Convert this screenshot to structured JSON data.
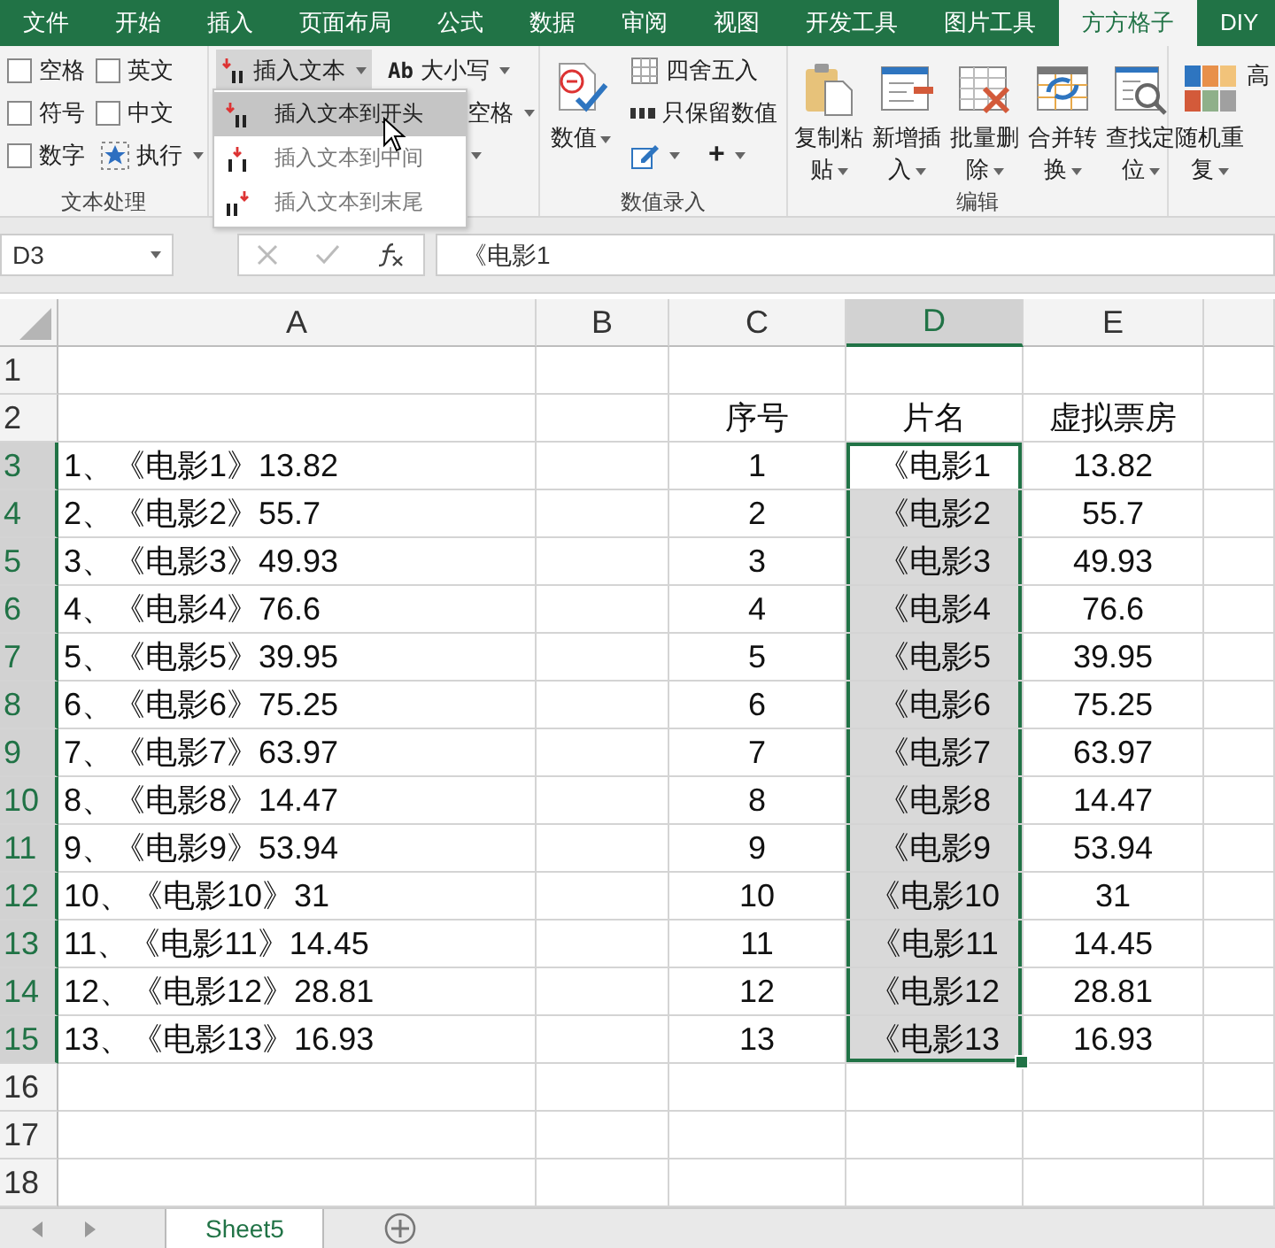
{
  "menu_tabs": [
    {
      "label": "文件",
      "selected": false
    },
    {
      "label": "开始",
      "selected": false
    },
    {
      "label": "插入",
      "selected": false
    },
    {
      "label": "页面布局",
      "selected": false
    },
    {
      "label": "公式",
      "selected": false
    },
    {
      "label": "数据",
      "selected": false
    },
    {
      "label": "审阅",
      "selected": false
    },
    {
      "label": "视图",
      "selected": false
    },
    {
      "label": "开发工具",
      "selected": false
    },
    {
      "label": "图片工具",
      "selected": false
    },
    {
      "label": "方方格子",
      "selected": true
    },
    {
      "label": "DIY",
      "selected": false
    }
  ],
  "ribbon": {
    "groups": [
      {
        "label": "文本处理",
        "columns": [
          [
            {
              "kind": "check",
              "label": "空格",
              "checked": false
            },
            {
              "kind": "check",
              "label": "符号",
              "checked": false
            },
            {
              "kind": "check",
              "label": "数字",
              "checked": false
            }
          ],
          [
            {
              "kind": "check",
              "label": "英文",
              "checked": false
            },
            {
              "kind": "check",
              "label": "中文",
              "checked": false
            },
            {
              "kind": "button",
              "label": "执行",
              "dropdown": true
            }
          ]
        ]
      },
      {
        "columns": [
          [
            {
              "kind": "button",
              "label": "插入文本",
              "dropdown": true,
              "expanded": true
            }
          ],
          [
            {
              "kind": "button",
              "badge": "Ab",
              "label": "大小写",
              "dropdown": true
            },
            {
              "kind": "button",
              "label": "空格",
              "dropdown": true
            },
            {
              "kind": "button",
              "dropdown": true
            }
          ]
        ]
      },
      {
        "label": "数值录入",
        "columns": [
          [
            {
              "kind": "large",
              "label": "数值",
              "dropdown": true
            }
          ],
          [
            {
              "kind": "button",
              "label": "四舍五入"
            },
            {
              "kind": "button",
              "label": "只保留数值"
            },
            {
              "kind": "tools",
              "items": [
                {
                  "dropdown": true
                },
                {
                  "label": "+",
                  "dropdown": true
                }
              ]
            }
          ]
        ]
      },
      {
        "label": "编辑",
        "columns": [
          [
            {
              "kind": "large",
              "label": "复制粘贴",
              "dropdown": true
            }
          ],
          [
            {
              "kind": "large",
              "label": "新增插入",
              "dropdown": true
            }
          ],
          [
            {
              "kind": "large",
              "label": "批量删除",
              "dropdown": true
            }
          ],
          [
            {
              "kind": "large",
              "label": "合并转换",
              "dropdown": true
            }
          ],
          [
            {
              "kind": "large",
              "label": "查找定位",
              "dropdown": true
            }
          ]
        ]
      },
      {
        "columns": [
          [
            {
              "kind": "large",
              "label": "随机重复",
              "dropdown": true
            }
          ],
          [
            {
              "kind": "large",
              "label": "高"
            }
          ]
        ]
      }
    ]
  },
  "dropdown_menu": {
    "items": [
      {
        "label": "插入文本到开头",
        "selected": true
      },
      {
        "label": "插入文本到中间",
        "selected": false
      },
      {
        "label": "插入文本到末尾",
        "selected": false
      }
    ]
  },
  "name_box": "D3",
  "formula": "《电影1",
  "columns": [
    {
      "label": "A",
      "selected": false
    },
    {
      "label": "B",
      "selected": false
    },
    {
      "label": "C",
      "selected": false
    },
    {
      "label": "D",
      "selected": true
    },
    {
      "label": "E",
      "selected": false
    }
  ],
  "rows": [
    {
      "number": "1",
      "d_selected": false
    },
    {
      "number": "2",
      "c": "序号",
      "d": "片名",
      "e": "虚拟票房",
      "d_selected": false
    },
    {
      "number": "3",
      "a": "1、《电影1》13.82",
      "c": "1",
      "d": "《电影1",
      "e": "13.82",
      "d_selected": true,
      "d_active": true
    },
    {
      "number": "4",
      "a": "2、《电影2》55.7",
      "c": "2",
      "d": "《电影2",
      "e": "55.7",
      "d_selected": true,
      "d_active": false
    },
    {
      "number": "5",
      "a": "3、《电影3》49.93",
      "c": "3",
      "d": "《电影3",
      "e": "49.93",
      "d_selected": true,
      "d_active": false
    },
    {
      "number": "6",
      "a": "4、《电影4》76.6",
      "c": "4",
      "d": "《电影4",
      "e": "76.6",
      "d_selected": true,
      "d_active": false
    },
    {
      "number": "7",
      "a": "5、《电影5》39.95",
      "c": "5",
      "d": "《电影5",
      "e": "39.95",
      "d_selected": true,
      "d_active": false
    },
    {
      "number": "8",
      "a": "6、《电影6》75.25",
      "c": "6",
      "d": "《电影6",
      "e": "75.25",
      "d_selected": true,
      "d_active": false
    },
    {
      "number": "9",
      "a": "7、《电影7》63.97",
      "c": "7",
      "d": "《电影7",
      "e": "63.97",
      "d_selected": true,
      "d_active": false
    },
    {
      "number": "10",
      "a": "8、《电影8》14.47",
      "c": "8",
      "d": "《电影8",
      "e": "14.47",
      "d_selected": true,
      "d_active": false
    },
    {
      "number": "11",
      "a": "9、《电影9》53.94",
      "c": "9",
      "d": "《电影9",
      "e": "53.94",
      "d_selected": true,
      "d_active": false
    },
    {
      "number": "12",
      "a": "10、《电影10》31",
      "c": "10",
      "d": "《电影10",
      "e": "31",
      "d_selected": true,
      "d_active": false
    },
    {
      "number": "13",
      "a": "11、《电影11》14.45",
      "c": "11",
      "d": "《电影11",
      "e": "14.45",
      "d_selected": true,
      "d_active": false
    },
    {
      "number": "14",
      "a": "12、《电影12》28.81",
      "c": "12",
      "d": "《电影12",
      "e": "28.81",
      "d_selected": true,
      "d_active": false
    },
    {
      "number": "15",
      "a": "13、《电影13》16.93",
      "c": "13",
      "d": "《电影13",
      "e": "16.93",
      "d_selected": true,
      "d_active": false
    },
    {
      "number": "16",
      "d_selected": false
    },
    {
      "number": "17",
      "d_selected": false
    },
    {
      "number": "18",
      "d_selected": false
    }
  ],
  "sheet_tabs": [
    {
      "label": "Sheet5",
      "selected": true
    }
  ]
}
